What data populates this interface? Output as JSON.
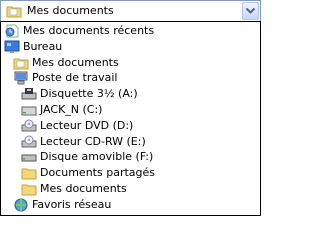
{
  "combo": {
    "selected_label": "Mes documents",
    "selected_icon": "my-documents-icon",
    "dropdown_icon": "chevron-down-icon"
  },
  "items": [
    {
      "label": "Mes documents récents",
      "icon": "recent-documents-icon",
      "level": 0
    },
    {
      "label": "Bureau",
      "icon": "desktop-icon",
      "level": 0
    },
    {
      "label": "Mes documents",
      "icon": "my-documents-icon",
      "level": 1
    },
    {
      "label": "Poste de travail",
      "icon": "my-computer-icon",
      "level": 1
    },
    {
      "label": "Disquette 3½ (A:)",
      "icon": "floppy-drive-icon",
      "level": 2
    },
    {
      "label": "JACK_N (C:)",
      "icon": "hard-drive-icon",
      "level": 2
    },
    {
      "label": "Lecteur DVD (D:)",
      "icon": "dvd-drive-icon",
      "level": 2
    },
    {
      "label": "Lecteur CD-RW (E:)",
      "icon": "cd-drive-icon",
      "level": 2
    },
    {
      "label": "Disque amovible (F:)",
      "icon": "removable-disk-icon",
      "level": 2
    },
    {
      "label": "Documents partagés",
      "icon": "folder-icon",
      "level": 2
    },
    {
      "label": "Mes documents",
      "icon": "folder-icon",
      "level": 2
    },
    {
      "label": "Favoris réseau",
      "icon": "network-places-icon",
      "level": 1
    }
  ],
  "colors": {
    "combo_border": "#7f9db9",
    "dropdown_border": "#000000",
    "folder": "#f4d77a",
    "folder_dark": "#c9a13a",
    "drive_gray": "#c0c0c0"
  }
}
